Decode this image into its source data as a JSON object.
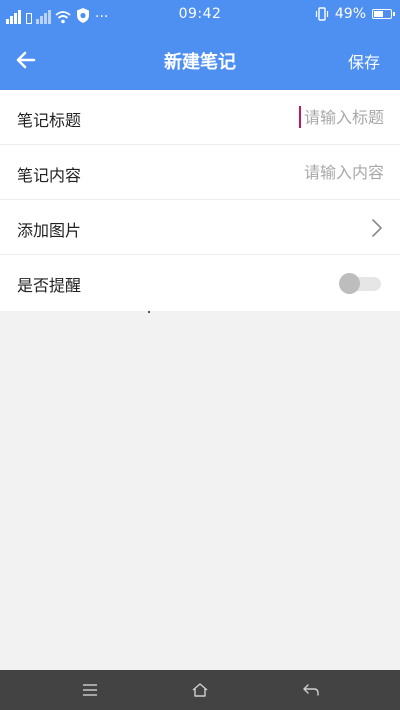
{
  "status_bar": {
    "time": "09:42",
    "battery_percent": "49%",
    "battery_level": 0.49,
    "more_indicator": "···"
  },
  "header": {
    "title": "新建笔记",
    "save_label": "保存",
    "back_icon": "arrow-left-icon"
  },
  "form": {
    "rows": [
      {
        "label": "笔记标题",
        "placeholder": "请输入标题",
        "value": ""
      },
      {
        "label": "笔记内容",
        "placeholder": "请输入内容",
        "value": ""
      },
      {
        "label": "添加图片"
      },
      {
        "label": "是否提醒",
        "toggle_on": false
      }
    ]
  },
  "nav_bar": {
    "icons": [
      "menu-icon",
      "home-icon",
      "back-icon"
    ]
  },
  "colors": {
    "accent": "#4e8ff2",
    "nav_bar": "#434343",
    "caret": "#c2185b"
  }
}
